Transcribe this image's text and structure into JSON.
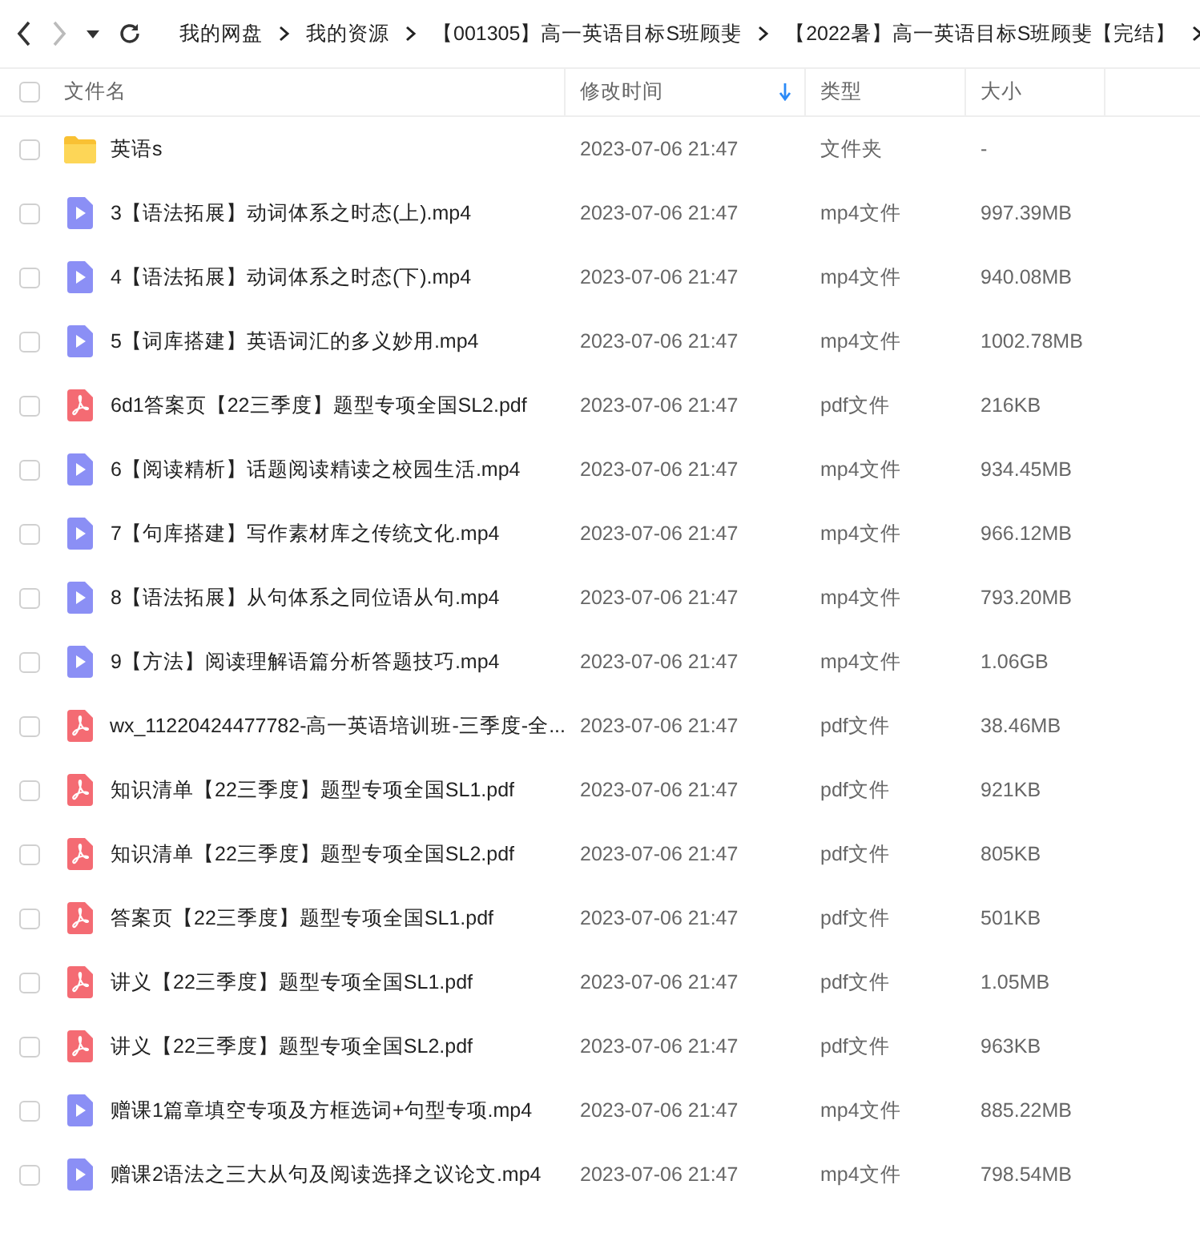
{
  "toolbar": {
    "breadcrumbs": [
      "我的网盘",
      "我的资源",
      "【001305】高一英语目标S班顾斐",
      "【2022暑】高一英语目标S班顾斐【完结】"
    ]
  },
  "table": {
    "columns": [
      {
        "label": "文件名",
        "sorted": false
      },
      {
        "label": "修改时间",
        "sorted": true
      },
      {
        "label": "类型",
        "sorted": false
      },
      {
        "label": "大小",
        "sorted": false
      }
    ],
    "rows": [
      {
        "kind": "folder",
        "name": "英语s",
        "modified": "2023-07-06 21:47",
        "type": "文件夹",
        "size": "-",
        "checked": false
      },
      {
        "kind": "video",
        "name": "3【语法拓展】动词体系之时态(上).mp4",
        "modified": "2023-07-06 21:47",
        "type": "mp4文件",
        "size": "997.39MB",
        "checked": false
      },
      {
        "kind": "video",
        "name": "4【语法拓展】动词体系之时态(下).mp4",
        "modified": "2023-07-06 21:47",
        "type": "mp4文件",
        "size": "940.08MB",
        "checked": false
      },
      {
        "kind": "video",
        "name": "5【词库搭建】英语词汇的多义妙用.mp4",
        "modified": "2023-07-06 21:47",
        "type": "mp4文件",
        "size": "1002.78MB",
        "checked": false
      },
      {
        "kind": "pdf",
        "name": "6d1答案页【22三季度】题型专项全国SL2.pdf",
        "modified": "2023-07-06 21:47",
        "type": "pdf文件",
        "size": "216KB",
        "checked": false
      },
      {
        "kind": "video",
        "name": "6【阅读精析】话题阅读精读之校园生活.mp4",
        "modified": "2023-07-06 21:47",
        "type": "mp4文件",
        "size": "934.45MB",
        "checked": false
      },
      {
        "kind": "video",
        "name": "7【句库搭建】写作素材库之传统文化.mp4",
        "modified": "2023-07-06 21:47",
        "type": "mp4文件",
        "size": "966.12MB",
        "checked": false
      },
      {
        "kind": "video",
        "name": "8【语法拓展】从句体系之同位语从句.mp4",
        "modified": "2023-07-06 21:47",
        "type": "mp4文件",
        "size": "793.20MB",
        "checked": false
      },
      {
        "kind": "video",
        "name": "9【方法】阅读理解语篇分析答题技巧.mp4",
        "modified": "2023-07-06 21:47",
        "type": "mp4文件",
        "size": "1.06GB",
        "checked": false
      },
      {
        "kind": "pdf",
        "name": "wx_11220424477782-高一英语培训班-三季度-全...",
        "modified": "2023-07-06 21:47",
        "type": "pdf文件",
        "size": "38.46MB",
        "checked": false
      },
      {
        "kind": "pdf",
        "name": "知识清单【22三季度】题型专项全国SL1.pdf",
        "modified": "2023-07-06 21:47",
        "type": "pdf文件",
        "size": "921KB",
        "checked": false
      },
      {
        "kind": "pdf",
        "name": "知识清单【22三季度】题型专项全国SL2.pdf",
        "modified": "2023-07-06 21:47",
        "type": "pdf文件",
        "size": "805KB",
        "checked": false
      },
      {
        "kind": "pdf",
        "name": "答案页【22三季度】题型专项全国SL1.pdf",
        "modified": "2023-07-06 21:47",
        "type": "pdf文件",
        "size": "501KB",
        "checked": false
      },
      {
        "kind": "pdf",
        "name": "讲义【22三季度】题型专项全国SL1.pdf",
        "modified": "2023-07-06 21:47",
        "type": "pdf文件",
        "size": "1.05MB",
        "checked": false
      },
      {
        "kind": "pdf",
        "name": "讲义【22三季度】题型专项全国SL2.pdf",
        "modified": "2023-07-06 21:47",
        "type": "pdf文件",
        "size": "963KB",
        "checked": false
      },
      {
        "kind": "video",
        "name": "赠课1篇章填空专项及方框选词+句型专项.mp4",
        "modified": "2023-07-06 21:47",
        "type": "mp4文件",
        "size": "885.22MB",
        "checked": false
      },
      {
        "kind": "video",
        "name": "赠课2语法之三大从句及阅读选择之议论文.mp4",
        "modified": "2023-07-06 21:47",
        "type": "mp4文件",
        "size": "798.54MB",
        "checked": false
      }
    ]
  }
}
